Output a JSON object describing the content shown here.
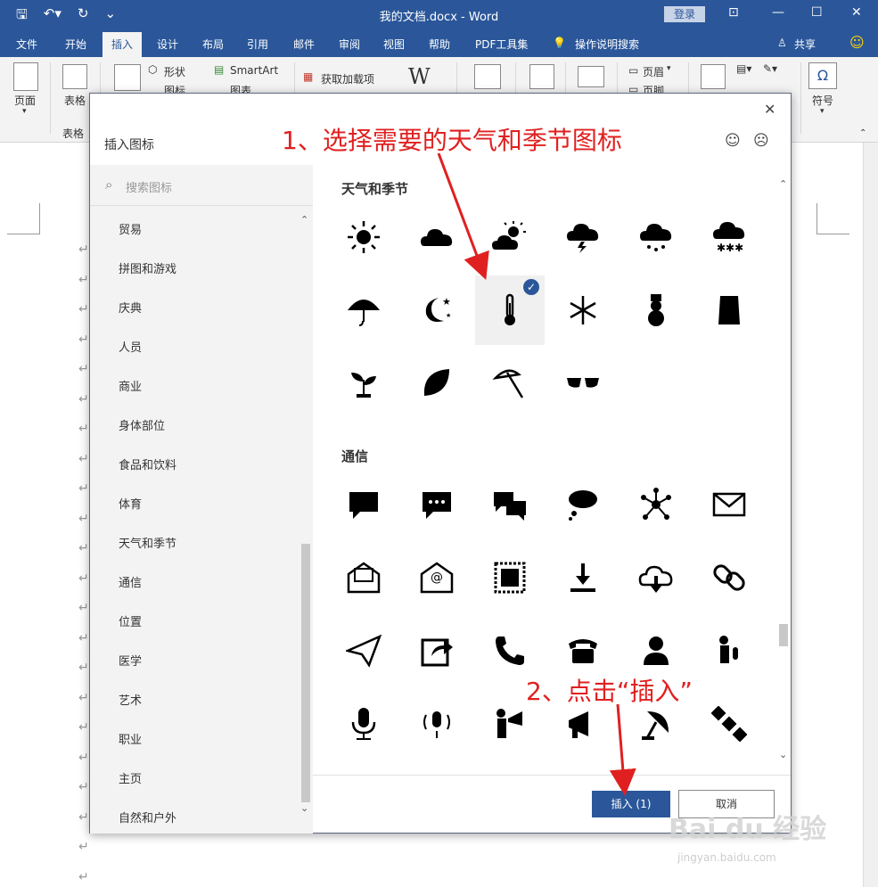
{
  "window": {
    "title": "我的文档.docx - Word",
    "login_label": "登录",
    "share_label": "共享"
  },
  "ribbon_tabs": [
    "文件",
    "开始",
    "插入",
    "设计",
    "布局",
    "引用",
    "邮件",
    "审阅",
    "视图",
    "帮助",
    "PDF工具集"
  ],
  "tell_me": "操作说明搜索",
  "ribbon": {
    "page": "页面",
    "table": "表格",
    "table_group": "表格",
    "shapes": "形状",
    "icons": "图标",
    "smartart": "SmartArt",
    "chart": "图表",
    "addins": "获取加载项",
    "wiki": "W",
    "header": "页眉",
    "footer": "页脚",
    "symbol": "符号",
    "omega": "Ω"
  },
  "dialog": {
    "title": "插入图标",
    "search_placeholder": "搜索图标",
    "categories": [
      "贸易",
      "拼图和游戏",
      "庆典",
      "人员",
      "商业",
      "身体部位",
      "食品和饮料",
      "体育",
      "天气和季节",
      "通信",
      "位置",
      "医学",
      "艺术",
      "职业",
      "主页",
      "自然和户外"
    ],
    "sections": [
      {
        "title": "天气和季节",
        "icons": [
          "sun-icon",
          "cloud-icon",
          "partly-sunny-icon",
          "thunderstorm-icon",
          "rain-icon",
          "snow-icon",
          "umbrella-icon",
          "moon-stars-icon",
          "thermometer-icon",
          "snowflake-icon",
          "snowman-icon",
          "seed-bag-icon",
          "sprout-icon",
          "leaf-icon",
          "beach-umbrella-icon",
          "sunglasses-icon"
        ]
      },
      {
        "title": "通信",
        "icons": [
          "speech-bubble-icon",
          "chat-dots-icon",
          "conversation-icon",
          "thought-bubble-icon",
          "network-icon",
          "envelope-icon",
          "open-letter-icon",
          "email-at-icon",
          "stamp-icon",
          "download-icon",
          "cloud-download-icon",
          "link-icon",
          "paper-plane-icon",
          "share-icon",
          "phone-icon",
          "desk-phone-icon",
          "call-center-icon",
          "microphone-person-icon",
          "microphone-icon",
          "podcast-icon",
          "speaker-person-icon",
          "megaphone-icon",
          "satellite-dish-icon",
          "satellite-icon"
        ]
      }
    ],
    "selected_icon": "thermometer-icon",
    "insert_label": "插入 (1)",
    "cancel_label": "取消"
  },
  "annotations": {
    "step1": "1、选择需要的天气和季节图标",
    "step2": "2、点击“插入”"
  },
  "watermark": {
    "brand": "Bai du 经验",
    "url": "jingyan.baidu.com"
  },
  "colors": {
    "word_blue": "#2b579a",
    "annotation_red": "#e02020"
  }
}
